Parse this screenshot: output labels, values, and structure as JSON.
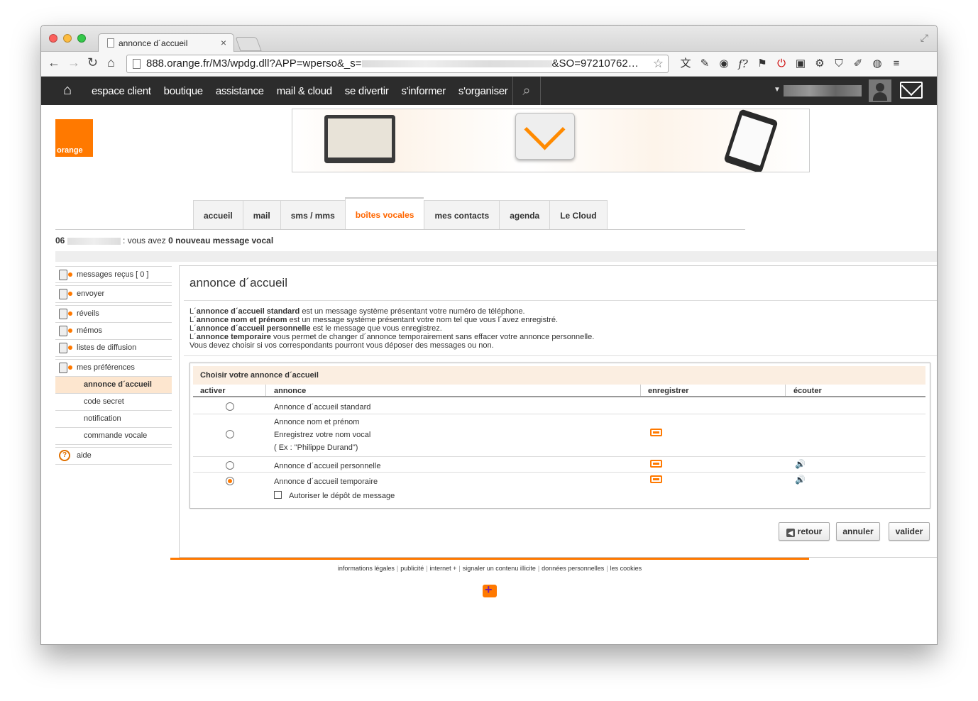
{
  "browser": {
    "tab_title": "annonce d´accueil",
    "tab_close": "×",
    "url_prefix": "888.orange.fr/M3/wpdg.dll?APP=wperso&_s=",
    "url_suffix": "&SO=97210762…"
  },
  "topnav": {
    "items": [
      "espace client",
      "boutique",
      "assistance",
      "mail & cloud",
      "se divertir",
      "s'informer",
      "s'organiser"
    ]
  },
  "logo": {
    "text": "orange"
  },
  "service_tabs": [
    "accueil",
    "mail",
    "sms / mms",
    "boîtes vocales",
    "mes contacts",
    "agenda",
    "Le Cloud"
  ],
  "active_tab": "boîtes vocales",
  "status": {
    "prefix": "06",
    "text": " : vous avez ",
    "count": "0 nouveau message vocal"
  },
  "sidebar": {
    "items": [
      {
        "label": "messages reçus [ 0 ]"
      },
      {
        "label": "envoyer"
      },
      {
        "label": "réveils"
      },
      {
        "label": "mémos"
      },
      {
        "label": "listes de diffusion"
      },
      {
        "label": "mes préférences"
      }
    ],
    "subitems": [
      "annonce d´accueil",
      "code secret",
      "notification",
      "commande vocale"
    ],
    "help": "aide"
  },
  "main": {
    "title": "annonce d´accueil",
    "desc": [
      {
        "pre": "L´",
        "bold": "annonce d´accueil standard",
        "post": " est un message système présentant votre numéro de téléphone."
      },
      {
        "pre": "L´",
        "bold": "annonce nom et prénom",
        "post": " est un message système présentant votre nom tel que vous l´avez enregistré."
      },
      {
        "pre": "L´",
        "bold": "annonce d´accueil personnelle",
        "post": " est le message que vous enregistrez."
      },
      {
        "pre": "L´",
        "bold": "annonce temporaire",
        "post": " vous permet de changer d´annonce temporairement sans effacer votre annonce personnelle."
      },
      {
        "pre": "Vous devez choisir si vos correspondants pourront vous déposer des messages ou non.",
        "bold": "",
        "post": ""
      }
    ],
    "box_title": "Choisir votre annonce d´accueil",
    "columns": [
      "activer",
      "annonce",
      "enregistrer",
      "écouter"
    ],
    "rows": [
      {
        "label": "Annonce d´accueil standard"
      },
      {
        "label": "Annonce nom et prénom",
        "line2": "Enregistrez votre nom vocal",
        "line3": "( Ex : \"Philippe Durand\")"
      },
      {
        "label": "Annonce d´accueil personnelle"
      },
      {
        "label": "Annonce d´accueil temporaire",
        "checkbox_label": "Autoriser le dépôt de message"
      }
    ],
    "selected_row": 4,
    "buttons": {
      "retour": "retour",
      "annuler": "annuler",
      "valider": "valider"
    }
  },
  "footer": {
    "links": [
      "informations légales",
      "publicité",
      "internet +",
      "signaler un contenu illicite",
      "données personnelles",
      "les cookies"
    ]
  }
}
